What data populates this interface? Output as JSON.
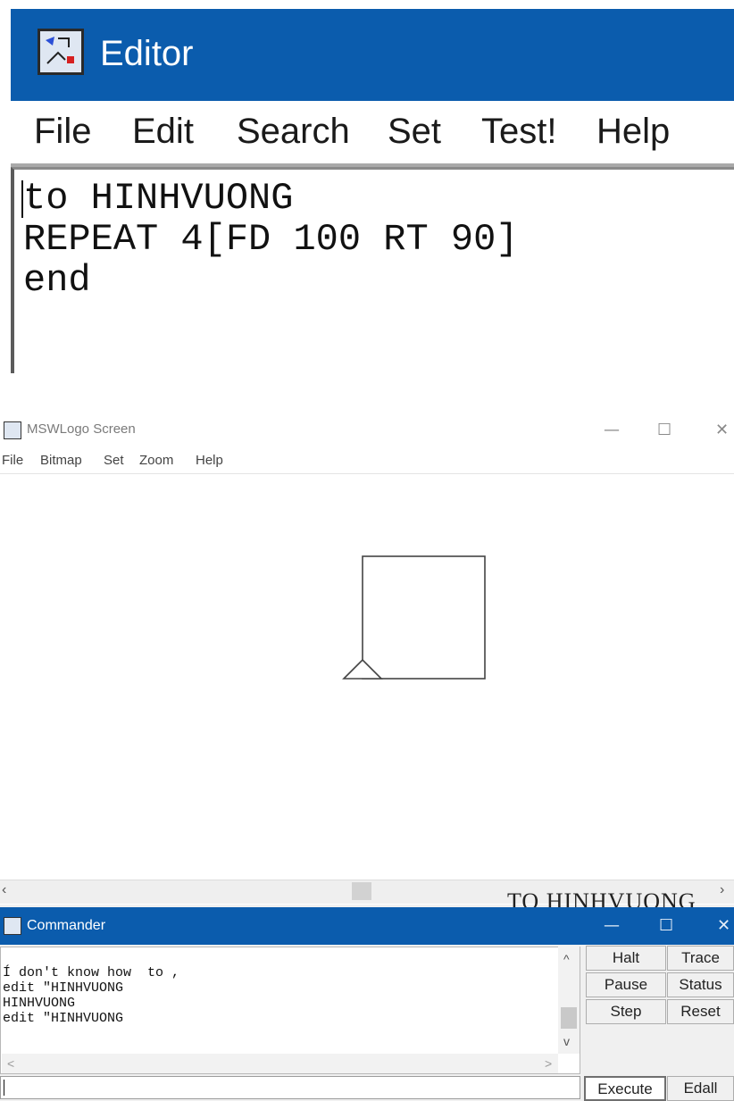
{
  "editor": {
    "title": "Editor",
    "menu": [
      "File",
      "Edit",
      "Search",
      "Set",
      "Test!",
      "Help"
    ],
    "code_lines": [
      "to HINHVUONG",
      "REPEAT 4[FD 100 RT 90]",
      "end"
    ]
  },
  "screen": {
    "title": "MSWLogo Screen",
    "window_controls": {
      "minimize": "—",
      "maximize": "☐",
      "close": "✕"
    },
    "menu": [
      "File",
      "Bitmap",
      "Set",
      "Zoom",
      "Help"
    ],
    "scroll_left": "‹",
    "scroll_right": "›"
  },
  "commander": {
    "overlap_text": "TO HINHVUONG",
    "title": "Commander",
    "window_controls": {
      "minimize": "—",
      "maximize": "☐",
      "close": "✕"
    },
    "output_lines": [
      "Í don't know how  to ,",
      "edit \"HINHVUONG",
      "HINHVUONG",
      "edit \"HINHVUONG"
    ],
    "scroll_up": "^",
    "scroll_down": "v",
    "scroll_left": "<",
    "scroll_right": ">",
    "buttons": {
      "halt": "Halt",
      "trace": "Trace",
      "pause": "Pause",
      "status": "Status",
      "step": "Step",
      "reset": "Reset",
      "execute": "Execute",
      "edall": "Edall"
    }
  }
}
